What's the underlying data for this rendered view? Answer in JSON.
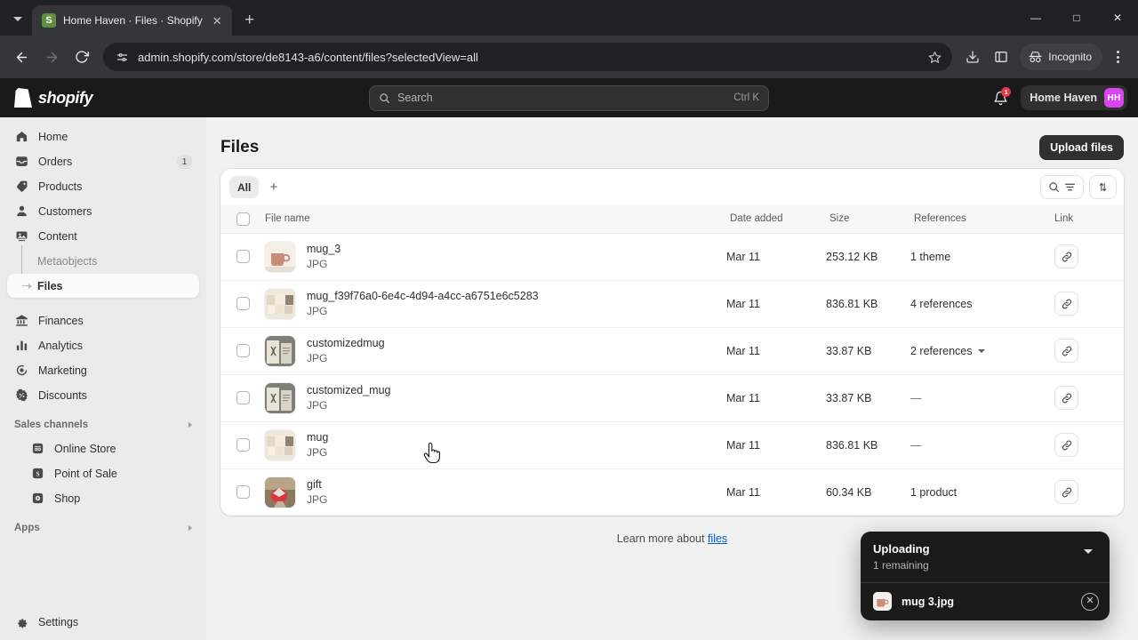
{
  "browser": {
    "tab": {
      "title": "Home Haven · Files · Shopify",
      "favicon": "shopify-bag-icon"
    },
    "new_tab_label": "+",
    "url": "admin.shopify.com/store/de8143-a6/content/files?selectedView=all",
    "incognito_label": "Incognito",
    "window_controls": {
      "minimize": "—",
      "maximize": "□",
      "close": "✕"
    }
  },
  "topbar": {
    "brand": "shopify",
    "search": {
      "placeholder": "Search",
      "shortcut": "Ctrl K"
    },
    "notifications_count": "1",
    "store_name": "Home Haven",
    "avatar_initials": "HH"
  },
  "sidebar": {
    "items": [
      {
        "label": "Home",
        "icon": "home-icon",
        "badge": ""
      },
      {
        "label": "Orders",
        "icon": "orders-icon",
        "badge": "1"
      },
      {
        "label": "Products",
        "icon": "products-tag-icon",
        "badge": ""
      },
      {
        "label": "Customers",
        "icon": "customers-person-icon",
        "badge": ""
      },
      {
        "label": "Content",
        "icon": "content-image-icon",
        "badge": ""
      }
    ],
    "content_children": [
      {
        "label": "Metaobjects",
        "active": false
      },
      {
        "label": "Files",
        "active": true
      }
    ],
    "items_lower": [
      {
        "label": "Finances",
        "icon": "finances-bank-icon",
        "badge": ""
      },
      {
        "label": "Analytics",
        "icon": "analytics-bars-icon",
        "badge": ""
      },
      {
        "label": "Marketing",
        "icon": "marketing-target-icon",
        "badge": ""
      },
      {
        "label": "Discounts",
        "icon": "discounts-percent-icon",
        "badge": ""
      }
    ],
    "sales_channels_label": "Sales channels",
    "channels": [
      {
        "label": "Online Store",
        "icon": "store-icon"
      },
      {
        "label": "Point of Sale",
        "icon": "pos-icon"
      },
      {
        "label": "Shop",
        "icon": "shop-icon"
      }
    ],
    "apps_label": "Apps",
    "settings_label": "Settings"
  },
  "main": {
    "page_title": "Files",
    "upload_button": "Upload files",
    "views": [
      {
        "label": "All",
        "active": true
      }
    ],
    "add_view_label": "+",
    "table": {
      "columns": [
        "File name",
        "Date added",
        "Size",
        "References",
        "Link"
      ],
      "rows": [
        {
          "name": "mug_3",
          "type": "JPG",
          "date": "Mar 11",
          "size": "253.12 KB",
          "references": "1 theme",
          "has_chevron": false,
          "thumb": "mug-pink"
        },
        {
          "name": "mug_f39f76a0-6e4c-4d94-a4cc-a6751e6c5283",
          "type": "JPG",
          "date": "Mar 11",
          "size": "836.81 KB",
          "references": "4 references",
          "has_chevron": false,
          "thumb": "mugs-group"
        },
        {
          "name": "customizedmug",
          "type": "JPG",
          "date": "Mar 11",
          "size": "33.87 KB",
          "references": "2 references",
          "has_chevron": true,
          "thumb": "custom-mug"
        },
        {
          "name": "customized_mug",
          "type": "JPG",
          "date": "Mar 11",
          "size": "33.87 KB",
          "references": "—",
          "has_chevron": false,
          "thumb": "custom-mug"
        },
        {
          "name": "mug",
          "type": "JPG",
          "date": "Mar 11",
          "size": "836.81 KB",
          "references": "—",
          "has_chevron": false,
          "thumb": "mugs-group"
        },
        {
          "name": "gift",
          "type": "JPG",
          "date": "Mar 11",
          "size": "60.34 KB",
          "references": "1 product",
          "has_chevron": false,
          "thumb": "gift-red"
        }
      ]
    },
    "footer_text": "Learn more about ",
    "footer_link": "files"
  },
  "toast": {
    "title": "Uploading",
    "subtitle": "1 remaining",
    "file_name": "mug 3.jpg"
  },
  "colors": {
    "accent_link": "#005bd3",
    "avatar": "#d946ef",
    "badge": "#e0384c",
    "dark_surface": "#1a1a1a"
  }
}
